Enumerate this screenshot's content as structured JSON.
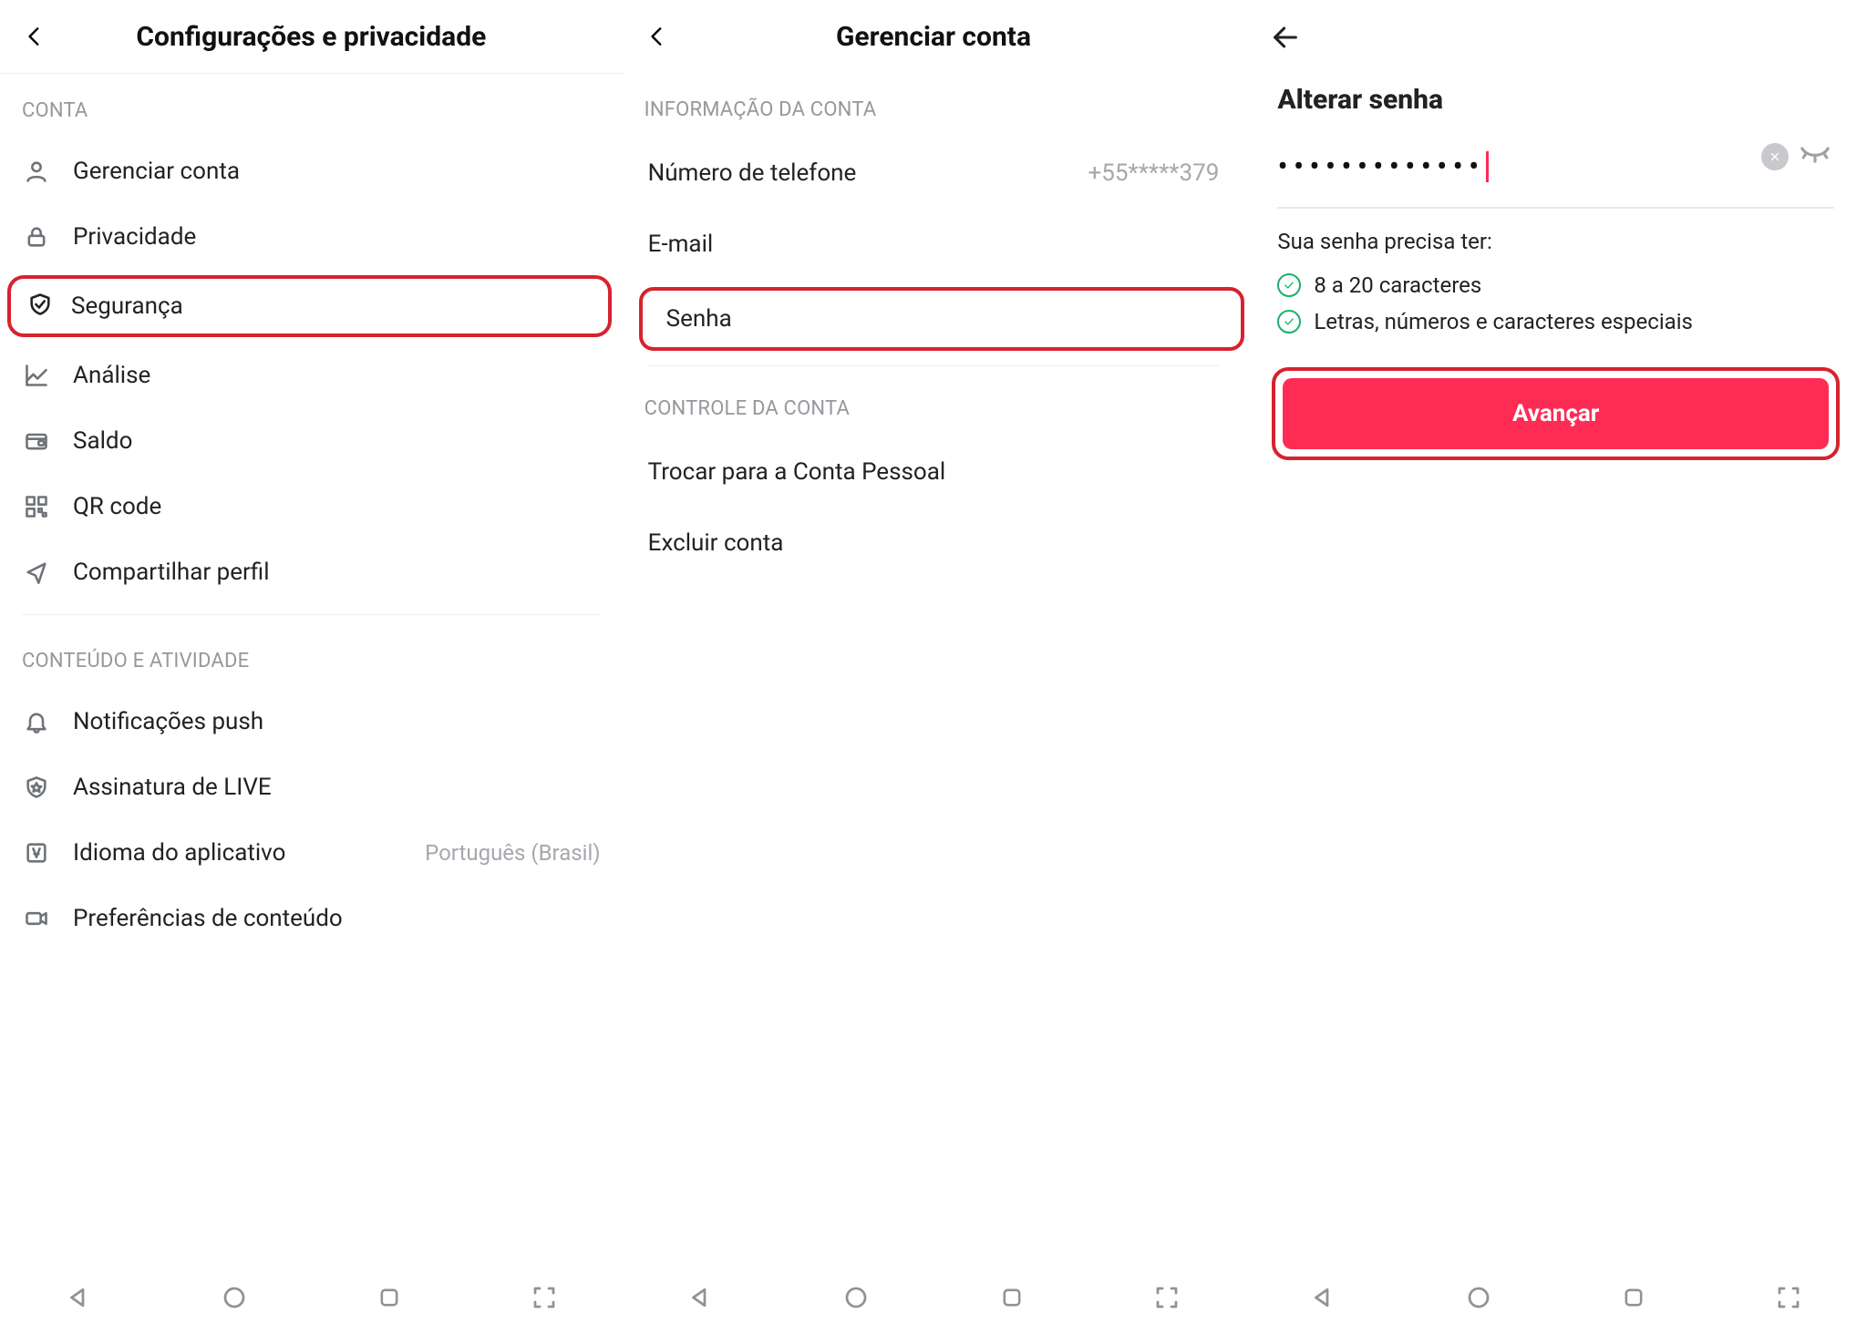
{
  "pane1": {
    "title": "Configurações e privacidade",
    "sections": {
      "conta": "CONTA",
      "conteudo": "CONTEÚDO E ATIVIDADE"
    },
    "items": {
      "gerenciar": "Gerenciar conta",
      "privacidade": "Privacidade",
      "seguranca": "Segurança",
      "analise": "Análise",
      "saldo": "Saldo",
      "qrcode": "QR code",
      "compartilhar": "Compartilhar perfil",
      "notificacoes": "Notificações push",
      "assinatura": "Assinatura de LIVE",
      "idioma": "Idioma do aplicativo",
      "idioma_val": "Português (Brasil)",
      "preferencias": "Preferências de conteúdo"
    }
  },
  "pane2": {
    "title": "Gerenciar conta",
    "sections": {
      "info": "INFORMAÇÃO DA CONTA",
      "controle": "CONTROLE DA CONTA"
    },
    "items": {
      "telefone": "Número de telefone",
      "telefone_val": "+55*****379",
      "email": "E-mail",
      "senha": "Senha",
      "trocar": "Trocar para a Conta Pessoal",
      "excluir": "Excluir conta"
    }
  },
  "pane3": {
    "title": "Alterar senha",
    "password_dots": "•••••••••••••",
    "reqs_title": "Sua senha precisa ter:",
    "req1": "8 a 20 caracteres",
    "req2": "Letras, números e caracteres especiais",
    "button": "Avançar"
  }
}
